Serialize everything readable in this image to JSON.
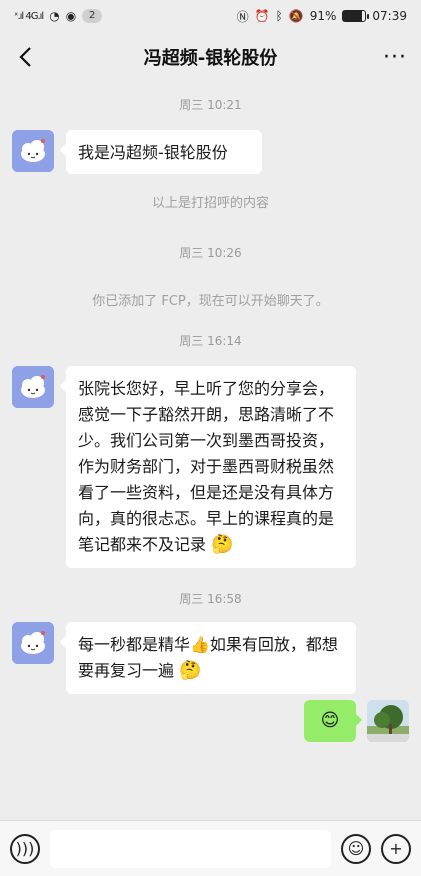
{
  "status": {
    "signal_left": "ˣ.ıl 4G.ıl",
    "notif_count": "2",
    "battery": "91%",
    "time": "07:39"
  },
  "chat": {
    "title": "冯超频-银轮股份"
  },
  "messages": [
    {
      "type": "time",
      "text": "周三 10:21"
    },
    {
      "type": "left",
      "text": "我是冯超频-银轮股份"
    },
    {
      "type": "system",
      "text": "以上是打招呼的内容"
    },
    {
      "type": "time",
      "text": "周三 10:26"
    },
    {
      "type": "system",
      "text": "你已添加了 FCP，现在可以开始聊天了。"
    },
    {
      "type": "time",
      "text": "周三 16:14"
    },
    {
      "type": "left",
      "text": "张院长您好，早上听了您的分享会，感觉一下子豁然开朗，思路清晰了不少。我们公司第一次到墨西哥投资，作为财务部门，对于墨西哥财税虽然看了一些资料，但是还是没有具体方向，真的很忐忑。早上的课程真的是笔记都来不及记录",
      "emoji": "🤔"
    },
    {
      "type": "time",
      "text": "周三 16:58"
    },
    {
      "type": "left",
      "text": "每一秒都是精华👍如果有回放，都想要再复习一遍",
      "emoji": "🤔"
    },
    {
      "type": "right",
      "emoji": "😊"
    }
  ],
  "icons": {
    "back": "chevron-left-icon",
    "more": "more-icon",
    "voice": "voice-icon",
    "emoji": "emoji-icon",
    "plus": "plus-icon"
  }
}
